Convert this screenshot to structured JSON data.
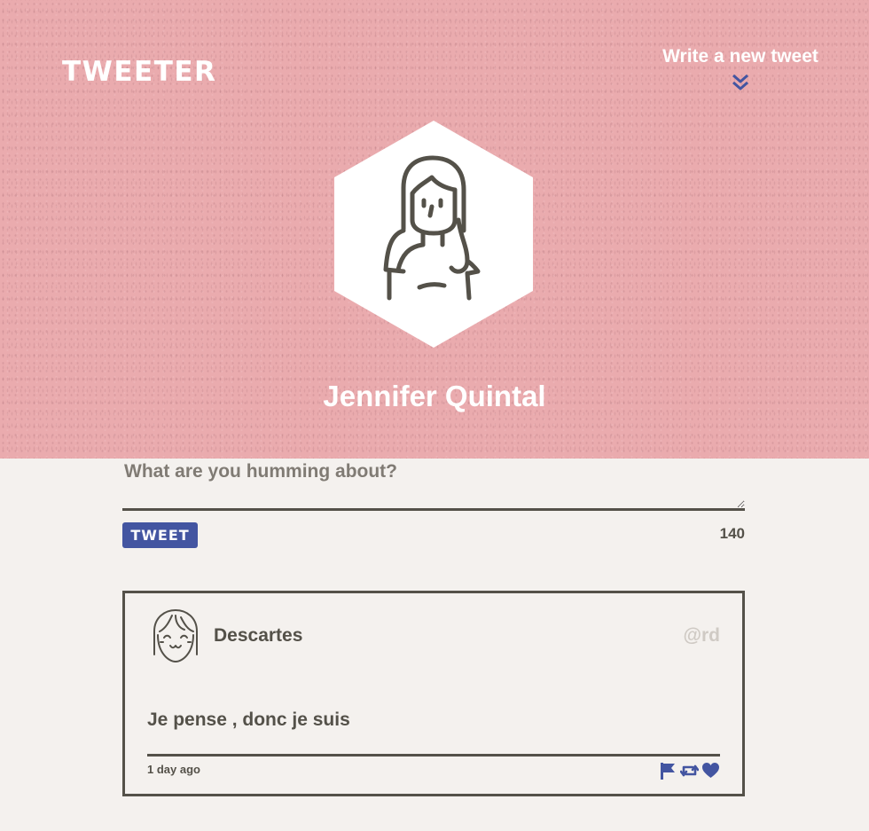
{
  "header": {
    "logo": "TWEETER",
    "compose_label": "Write a new tweet"
  },
  "profile": {
    "name": "Jennifer Quintal"
  },
  "composer": {
    "placeholder": "What are you humming about?",
    "button_label": "TWEET",
    "char_count": "140"
  },
  "tweets": [
    {
      "author": "Descartes",
      "handle": "@rd",
      "text": "Je pense , donc je suis",
      "time": "1 day ago",
      "actions": [
        "flag-icon",
        "retweet-icon",
        "heart-icon"
      ]
    }
  ],
  "colors": {
    "hero": "#eaabae",
    "background": "#f4f1ee",
    "accent": "#4355a1",
    "text": "#545149",
    "muted": "#cfcac4"
  }
}
